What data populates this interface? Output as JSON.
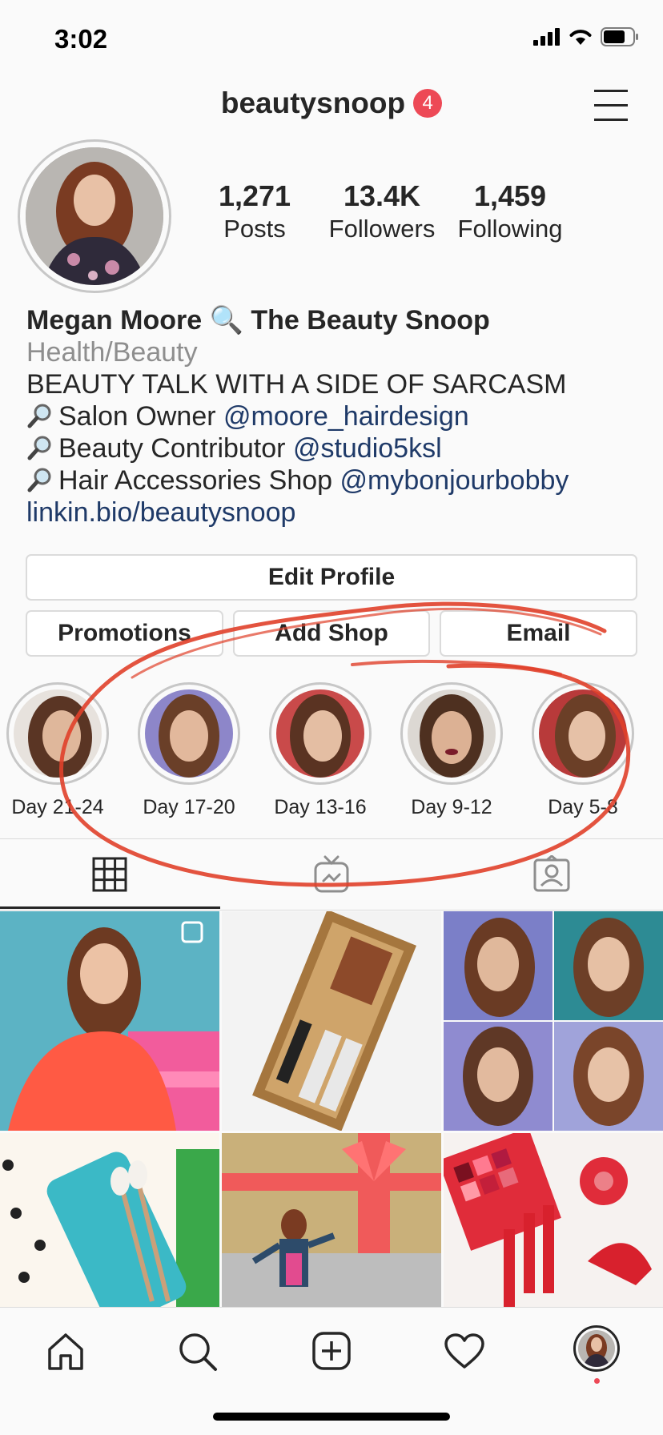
{
  "status_bar": {
    "time": "3:02"
  },
  "header": {
    "username": "beautysnoop",
    "notification_count": "4"
  },
  "stats": [
    {
      "value": "1,271",
      "label": "Posts"
    },
    {
      "value": "13.4K",
      "label": "Followers"
    },
    {
      "value": "1,459",
      "label": "Following"
    }
  ],
  "bio": {
    "name": "Megan Moore 🔍 The Beauty Snoop",
    "category": "Health/Beauty",
    "tagline": "BEAUTY TALK WITH A SIDE OF SARCASM",
    "lines": [
      {
        "text": "Salon Owner ",
        "mention": "@moore_hairdesign"
      },
      {
        "text": "Beauty Contributor ",
        "mention": "@studio5ksl"
      },
      {
        "text": "Hair Accessories Shop ",
        "mention": "@mybonjourbobby"
      }
    ],
    "link": "linkin.bio/beautysnoop"
  },
  "buttons": {
    "edit_profile": "Edit Profile",
    "promotions": "Promotions",
    "add_shop": "Add Shop",
    "email": "Email"
  },
  "highlights": [
    {
      "label": "Day 21-24"
    },
    {
      "label": "Day 17-20"
    },
    {
      "label": "Day 13-16"
    },
    {
      "label": "Day 9-12"
    },
    {
      "label": "Day 5-8"
    }
  ],
  "tabs": [
    "grid-icon",
    "igtv-icon",
    "tagged-icon"
  ],
  "bottom_nav": [
    "home-icon",
    "search-icon",
    "new-post-icon",
    "heart-icon",
    "profile-avatar"
  ],
  "colors": {
    "badge": "#ed4956",
    "link": "#1f3a68",
    "annotation": "#e0402a"
  }
}
